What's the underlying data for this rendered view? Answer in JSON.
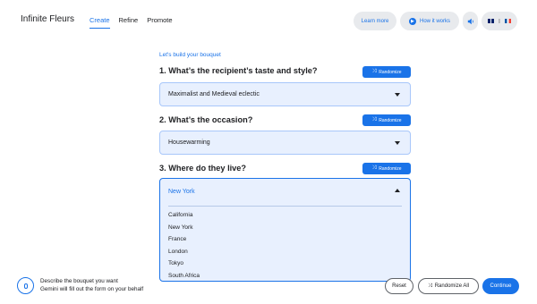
{
  "header": {
    "logo": "Infinite Fleurs",
    "tabs": [
      {
        "label": "Create",
        "active": true
      },
      {
        "label": "Refine",
        "active": false
      },
      {
        "label": "Promote",
        "active": false
      }
    ],
    "learn_more": "Learn more",
    "how_it_works": "How it works",
    "speaker_icon": "speaker-icon",
    "flags": [
      "uk-flag-icon",
      "fr-flag-icon"
    ]
  },
  "form": {
    "intro": "Let's build your bouquet",
    "randomize_label": "Randomize",
    "questions": [
      {
        "title": "1. What’s the recipient’s taste and style?",
        "value": "Maximalist and Medieval eclectic"
      },
      {
        "title": "2. What’s the occasion?",
        "value": "Housewarming"
      },
      {
        "title": "3. Where do they live?",
        "value": "New York",
        "open": true,
        "options": [
          "California",
          "New York",
          "France",
          "London",
          "Tokyo",
          "South Africa"
        ]
      }
    ]
  },
  "footer": {
    "mic_icon": "microphone-icon",
    "line1": "Describe the bouquet you want",
    "line2": "Gemini will fill out the form on your behalf",
    "reset": "Reset",
    "randomize_all": "Randomize All",
    "continue": "Continue"
  },
  "colors": {
    "accent": "#1a73e8",
    "field_bg": "#e8f0fe"
  }
}
